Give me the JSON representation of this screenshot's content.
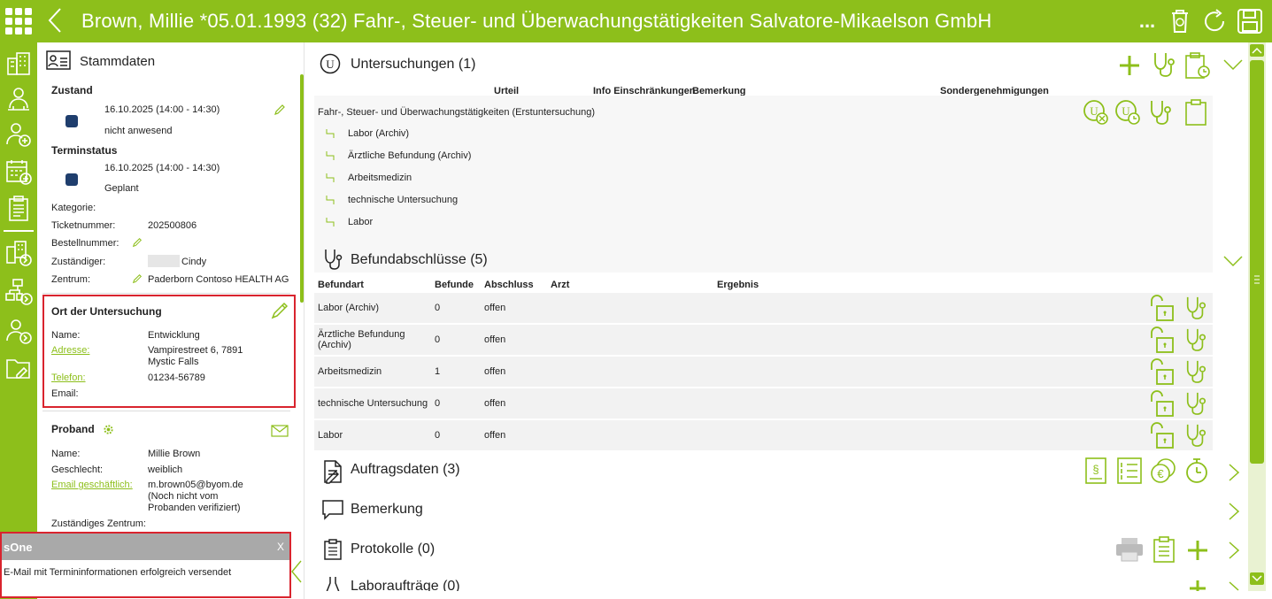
{
  "header": {
    "title": "Brown, Millie *05.01.1993 (32) Fahr-, Steuer- und Überwachungstätigkeiten Salvatore-Mikaelson GmbH",
    "more_label": "...",
    "bg": "#8dbf1b"
  },
  "sidebar": {
    "title": "Stammdaten",
    "zustand": {
      "label": "Zustand",
      "time": "16.10.2025 (14:00 - 14:30)",
      "status": "nicht anwesend",
      "color": "#1f3e6d"
    },
    "terminstatus": {
      "label": "Terminstatus",
      "time": "16.10.2025 (14:00 - 14:30)",
      "status": "Geplant",
      "color": "#1f3e6d"
    },
    "fields": [
      {
        "label": "Kategorie:",
        "value": ""
      },
      {
        "label": "Ticketnummer:",
        "value": "202500806"
      },
      {
        "label": "Bestellnummer:",
        "value": ""
      },
      {
        "label": "Zuständiger:",
        "value": "Cindy"
      },
      {
        "label": "Zentrum:",
        "value": "Paderborn Contoso HEALTH AG"
      }
    ],
    "ort": {
      "title": "Ort der Untersuchung",
      "name_label": "Name:",
      "name": "Entwicklung",
      "adresse_label": "Adresse:",
      "adresse_line1": "Vampirestreet 6, 7891",
      "adresse_line2": "Mystic Falls",
      "telefon_label": "Telefon:",
      "telefon": "01234-56789",
      "email_label": "Email:"
    },
    "proband": {
      "title": "Proband",
      "name_label": "Name:",
      "name": "Millie Brown",
      "geschlecht_label": "Geschlecht:",
      "geschlecht": "weiblich",
      "email_label": "Email geschäftlich:",
      "email": "m.brown05@byom.de",
      "email_note1": "(Noch nicht vom",
      "email_note2": "Probanden verifiziert)",
      "zentrum_label": "Zuständiges Zentrum:"
    }
  },
  "toast": {
    "title": "sOne",
    "close": "X",
    "message": "E-Mail mit Termininformationen erfolgreich versendet"
  },
  "untersuchungen": {
    "title": "Untersuchungen (1)",
    "headers": [
      "Urteil",
      "Info Einschränkungen",
      "Bemerkung",
      "Sondergenehmigungen"
    ],
    "group": "Fahr-, Steuer- und Überwachungstätigkeiten (Erstuntersuchung)",
    "items": [
      "Labor (Archiv)",
      "Ärztliche Befundung (Archiv)",
      "Arbeitsmedizin",
      "technische Untersuchung",
      "Labor"
    ]
  },
  "befund": {
    "title": "Befundabschlüsse (5)",
    "headers": [
      "Befundart",
      "Befunde",
      "Abschluss",
      "Arzt",
      "Ergebnis"
    ],
    "rows": [
      {
        "art": "Labor (Archiv)",
        "art2": "",
        "befunde": "0",
        "abschluss": "offen"
      },
      {
        "art": "Ärztliche Befundung",
        "art2": "(Archiv)",
        "befunde": "0",
        "abschluss": "offen"
      },
      {
        "art": "Arbeitsmedizin",
        "art2": "",
        "befunde": "1",
        "abschluss": "offen"
      },
      {
        "art": "technische Untersuchung",
        "art2": "",
        "befunde": "0",
        "abschluss": "offen"
      },
      {
        "art": "Labor",
        "art2": "",
        "befunde": "0",
        "abschluss": "offen"
      }
    ]
  },
  "sections": {
    "auftrag": "Auftragsdaten (3)",
    "bemerkung": "Bemerkung",
    "protokolle": "Protokolle (0)",
    "labor": "Laboraufträge (0)"
  },
  "colors": {
    "accent": "#8dbf1b",
    "highlight": "#d9242e"
  }
}
